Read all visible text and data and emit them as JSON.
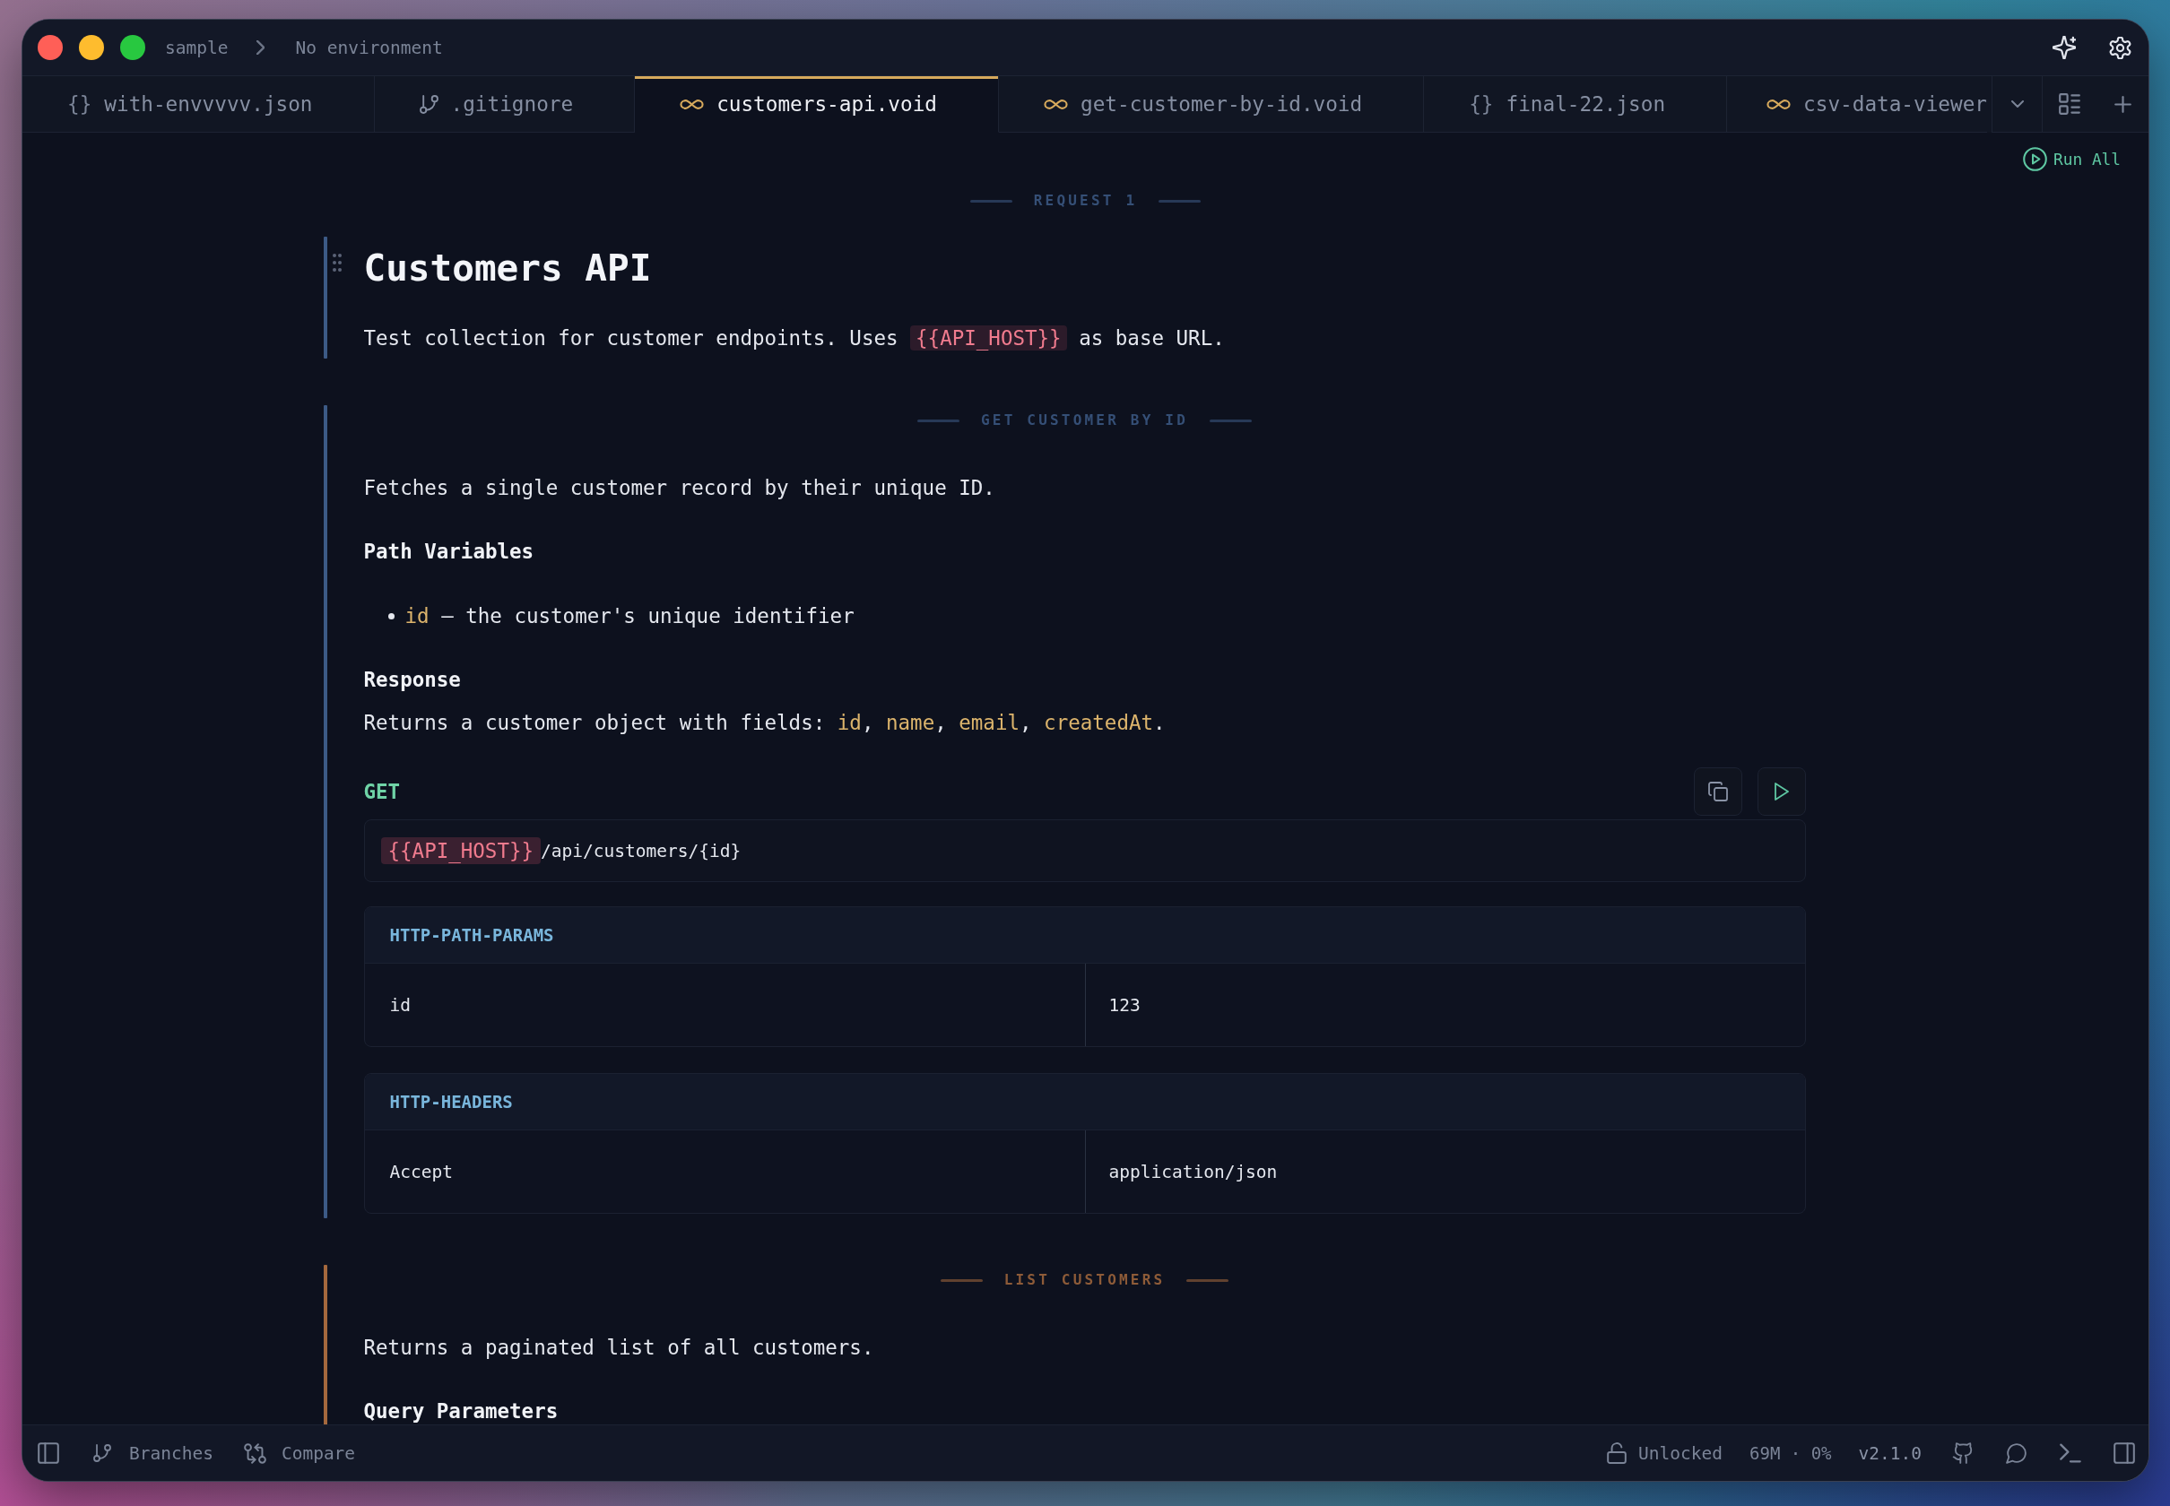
{
  "title_bar": {
    "workspace": "sample",
    "environment": "No environment"
  },
  "tabs": [
    {
      "kind": "json",
      "icon": "{}",
      "label": "with-envvvvv.json",
      "selected": false
    },
    {
      "kind": "git",
      "label": ".gitignore",
      "selected": false
    },
    {
      "kind": "void",
      "label": "customers-api.void",
      "selected": true
    },
    {
      "kind": "void",
      "label": "get-customer-by-id.void",
      "selected": false
    },
    {
      "kind": "json",
      "icon": "{}",
      "label": "final-22.json",
      "selected": false
    },
    {
      "kind": "void",
      "label": "csv-data-viewer",
      "selected": false
    }
  ],
  "toolbar": {
    "run_all": "Run All"
  },
  "blocks": [
    {
      "kind": "intro",
      "label": "REQUEST 1",
      "color": "#3c5a86",
      "title": "Customers API",
      "content": [
        {
          "kind": "paragraph",
          "segments": [
            {
              "text": "Test collection for customer endpoints. Uses "
            },
            {
              "kind": "code",
              "text": "{{API_HOST}}"
            },
            {
              "text": " as base URL."
            }
          ]
        }
      ]
    },
    {
      "kind": "request",
      "label": "GET CUSTOMER BY ID",
      "color": "#3c5a86",
      "content": [
        {
          "kind": "paragraph",
          "segments": [
            {
              "text": "Fetches a single customer record by their unique ID."
            }
          ]
        },
        {
          "kind": "heading",
          "text": "Path Variables"
        },
        {
          "kind": "list",
          "items": [
            {
              "segments": [
                {
                  "kind": "field",
                  "text": "id"
                },
                {
                  "text": " — the customer's unique identifier"
                }
              ]
            }
          ]
        },
        {
          "kind": "heading",
          "text": "Response"
        },
        {
          "kind": "paragraph",
          "segments": [
            {
              "text": "Returns a customer object with fields: "
            },
            {
              "kind": "field",
              "text": "id"
            },
            {
              "text": ", "
            },
            {
              "kind": "field",
              "text": "name"
            },
            {
              "text": ", "
            },
            {
              "kind": "field",
              "text": "email"
            },
            {
              "text": ", "
            },
            {
              "kind": "field",
              "text": "createdAt"
            },
            {
              "text": "."
            }
          ]
        },
        {
          "kind": "http",
          "method": "GET",
          "url": [
            {
              "kind": "variable",
              "text": "{{API_HOST}}"
            },
            {
              "text": "/api/customers/{id}"
            }
          ],
          "tables": [
            {
              "title": "HTTP-PATH-PARAMS",
              "rows": [
                [
                  "id",
                  "123"
                ]
              ]
            },
            {
              "title": "HTTP-HEADERS",
              "rows": [
                [
                  "Accept",
                  "application/json"
                ]
              ]
            }
          ]
        }
      ]
    },
    {
      "kind": "request",
      "label": "LIST CUSTOMERS",
      "color": "#a4683d",
      "content": [
        {
          "kind": "paragraph",
          "segments": [
            {
              "text": "Returns a paginated list of all customers."
            }
          ]
        },
        {
          "kind": "heading",
          "text": "Query Parameters"
        }
      ]
    }
  ],
  "status_bar": {
    "branches": "Branches",
    "compare": "Compare",
    "lock": "Unlocked",
    "stats": "69M · 0%",
    "version": "v2.1.0"
  }
}
